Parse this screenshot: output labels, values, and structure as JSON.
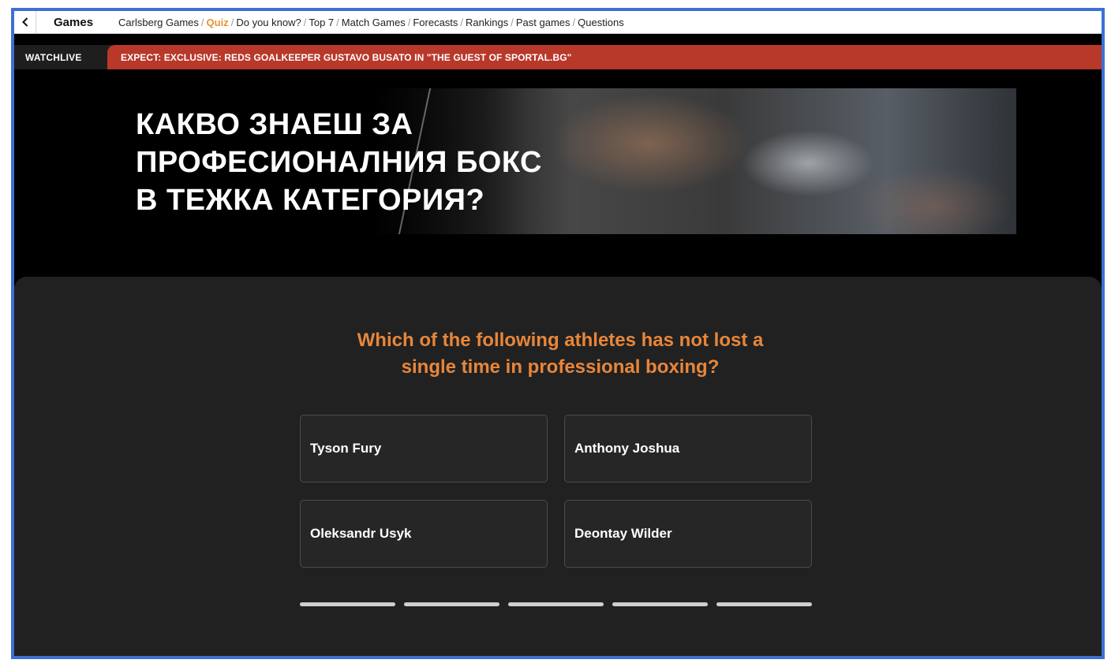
{
  "nav": {
    "title": "Games",
    "breadcrumbs": [
      {
        "label": "Carlsberg Games",
        "active": false
      },
      {
        "label": "Quiz",
        "active": true
      },
      {
        "label": "Do you know?",
        "active": false
      },
      {
        "label": "Top 7",
        "active": false
      },
      {
        "label": "Match Games",
        "active": false
      },
      {
        "label": "Forecasts",
        "active": false
      },
      {
        "label": "Rankings",
        "active": false
      },
      {
        "label": "Past games",
        "active": false
      },
      {
        "label": "Questions",
        "active": false
      }
    ],
    "back_icon": "chevron-left-icon"
  },
  "ticker": {
    "label": "WATCHLIVE",
    "headline": "EXPECT: EXCLUSIVE: REDS GOALKEEPER GUSTAVO BUSATO IN \"THE GUEST OF SPORTAL.BG\""
  },
  "banner": {
    "title_lines": [
      "КАКВО ЗНАЕШ ЗА",
      "ПРОФЕСИОНАЛНИЯ БОКС",
      "В ТЕЖКА КАТЕГОРИЯ?"
    ]
  },
  "quiz": {
    "question_lines": [
      "Which of the following athletes has not lost a",
      "single time in professional boxing?"
    ],
    "answers": [
      "Tyson Fury",
      "Anthony Joshua",
      "Oleksandr Usyk",
      "Deontay Wilder"
    ],
    "progress_segments": 5
  },
  "colors": {
    "accent_orange": "#e8863a",
    "ticker_red": "#b8382a",
    "panel_bg": "#212121",
    "frame_border": "#3d6fd6"
  }
}
